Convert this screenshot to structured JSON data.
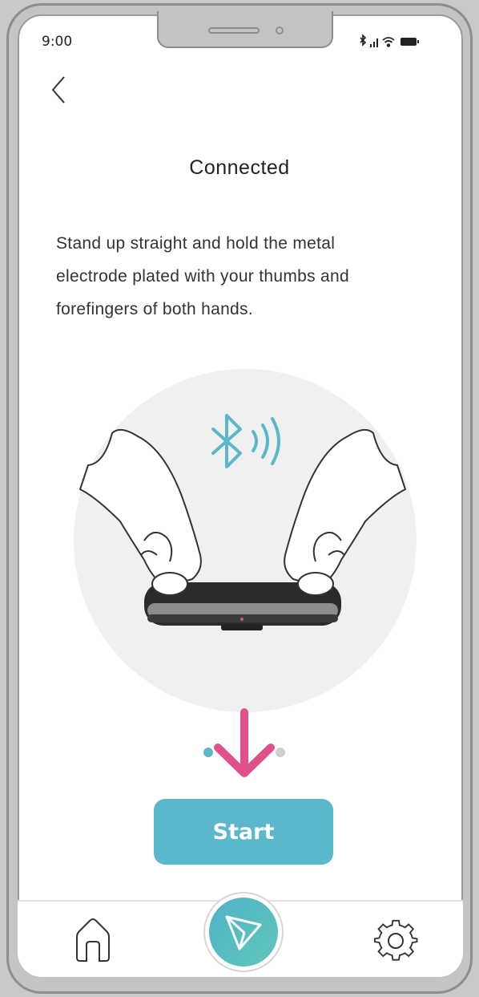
{
  "status_bar": {
    "time": "9:00"
  },
  "page": {
    "title": "Connected",
    "instruction_lines": [
      "Stand up straight and hold the metal",
      "electrode plated with your thumbs and",
      "forefingers of both hands."
    ]
  },
  "start_button": {
    "label": "Start"
  },
  "bottom_nav": {
    "items": [
      {
        "icon": "home-icon"
      },
      {
        "icon": "send-icon"
      },
      {
        "icon": "gear-icon"
      }
    ]
  },
  "colors": {
    "accent": "#5bb8ca",
    "arrow": "#e0508a",
    "bluetooth": "#5bb8ca"
  }
}
